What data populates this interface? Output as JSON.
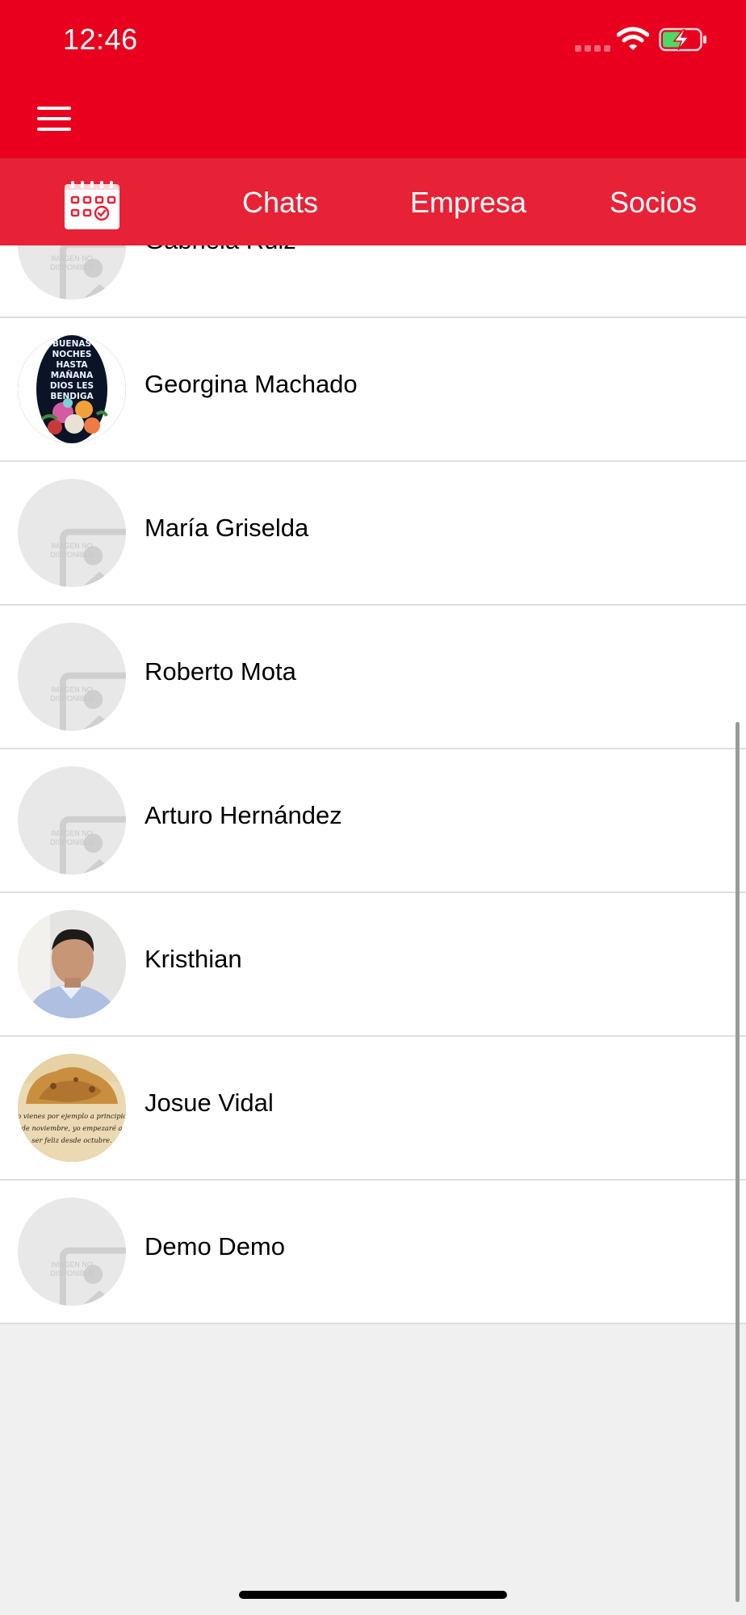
{
  "status_bar": {
    "time": "12:46",
    "wifi_icon": "wifi-icon",
    "battery_icon": "battery-charging-icon"
  },
  "app_bar": {
    "menu_icon": "hamburger-menu-icon",
    "background": "#e8001e"
  },
  "tabs": {
    "calendar_icon": "calendar-check-icon",
    "items": [
      {
        "label": "Chats"
      },
      {
        "label": "Empresa"
      },
      {
        "label": "Socios"
      }
    ],
    "background": "#e82236"
  },
  "contacts": [
    {
      "name": "Gabriela Ruiz",
      "avatar": "placeholder"
    },
    {
      "name": "Georgina Machado",
      "avatar": "image",
      "image_text": [
        "BUENAS",
        "NOCHES",
        "HASTA",
        "MAÑANA",
        "DIOS LES",
        "BENDIGA"
      ]
    },
    {
      "name": "María Griselda",
      "avatar": "placeholder"
    },
    {
      "name": "Roberto Mota",
      "avatar": "placeholder"
    },
    {
      "name": "Arturo Hernández",
      "avatar": "placeholder"
    },
    {
      "name": "Kristhian",
      "avatar": "photo"
    },
    {
      "name": "Josue Vidal",
      "avatar": "image",
      "image_text": [
        "Yo vienes por ejemplo a principios",
        "de noviembre, yo empezaré a",
        "ser feliz desde octubre."
      ]
    },
    {
      "name": "Demo Demo",
      "avatar": "placeholder"
    }
  ],
  "placeholder": {
    "line1": "Imagen no",
    "line2": "disponible",
    "icon": "image-placeholder-icon"
  },
  "colors": {
    "accent": "#e8001e",
    "tab_bar": "#e82236",
    "list_background": "#ffffff",
    "page_background": "#f0f0f0"
  }
}
